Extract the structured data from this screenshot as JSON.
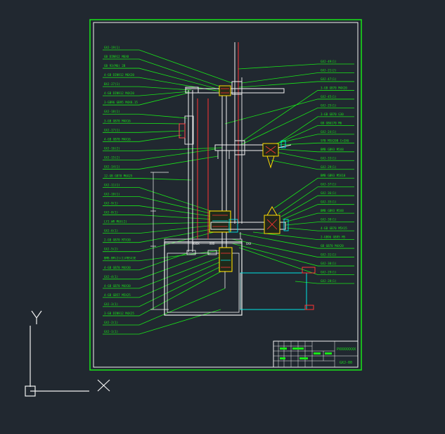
{
  "drawing": {
    "left_labels": [
      "GXJ-19(1)",
      "GB DIN912 M6X8",
      "GB 93(M6) 2B",
      "4-GB DIN912 M6X20",
      "BXJ-27(1)",
      "4-GB DIN912 M4X20",
      "3-GB96 GB95 M4X8.15",
      "GXJ-18(1)",
      "3-GB GB70 M4X16",
      "GXJ-17(1)",
      "4-GB GB70 M4X16",
      "GXJ-16(2)",
      "GXJ-15(2)",
      "GXJ-14(1)",
      "12-GB GB70 M6X25",
      "GXJ-11(1)",
      "GXJ-10(1)",
      "GXJ-9(1)",
      "GXJ-8(1)",
      "LYJ.WR M6X(2)",
      "GXJ-6(1)",
      "2-GB GB70 M7X30",
      "GXJ-5(2)",
      "BMB.BM(2)(1)PB5X3E",
      "4-GB GB70 M4X30",
      "GXJ-4(1)",
      "4-GB GB70 M4X30",
      "4-GB GB57 M5X25",
      "GXJ-3(1)",
      "3-GB DIN912 M4X25",
      "GXJ-2(1)",
      "GXJ-1(1)"
    ],
    "right_labels": [
      "GXJ-49(1)",
      "GXJ-21(2)",
      "GXJ-47(1)",
      "3-GB GB70 M4X20",
      "GXJ-45(1)",
      "GXJ-25(1)",
      "3-GB GB70 G30",
      "GB GB6170 M6",
      "GXJ-24(1)",
      "SFB M5X20B C=3X6",
      "BMB GB93 M5X8",
      "GXJ-33(1)",
      "GXJ-29(1)",
      "BMB GB93 M5X10",
      "GXJ-37(1)",
      "GXJ-36(1)",
      "GXJ-35(1)",
      "BMB GB93 M5X8",
      "GXJ-30(1)",
      "4-GB GB70 M5X15",
      "2-GB96 GB95 M5",
      "GB GB70 M4X20",
      "GXJ-31(1)",
      "GXJ-30(1)",
      "GXJ-29(1)",
      "GXJ-28(1)"
    ],
    "title_block": {
      "name": "PXXXXXXXX",
      "code": "GXJ-00"
    }
  }
}
